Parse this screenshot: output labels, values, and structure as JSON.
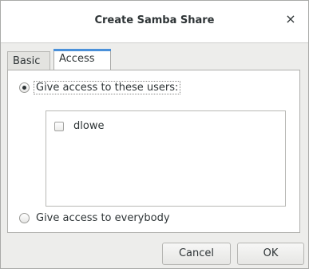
{
  "window": {
    "title": "Create Samba Share",
    "close_symbol": "×"
  },
  "tabs": [
    {
      "label": "Basic",
      "active": false
    },
    {
      "label": "Access",
      "active": true
    }
  ],
  "access": {
    "option_users_label": "Give access to these users:",
    "option_users_selected": true,
    "users": [
      {
        "name": "dlowe",
        "checked": false
      }
    ],
    "option_everybody_label": "Give access to everybody",
    "option_everybody_selected": false
  },
  "buttons": {
    "cancel_label": "Cancel",
    "ok_label": "OK"
  }
}
